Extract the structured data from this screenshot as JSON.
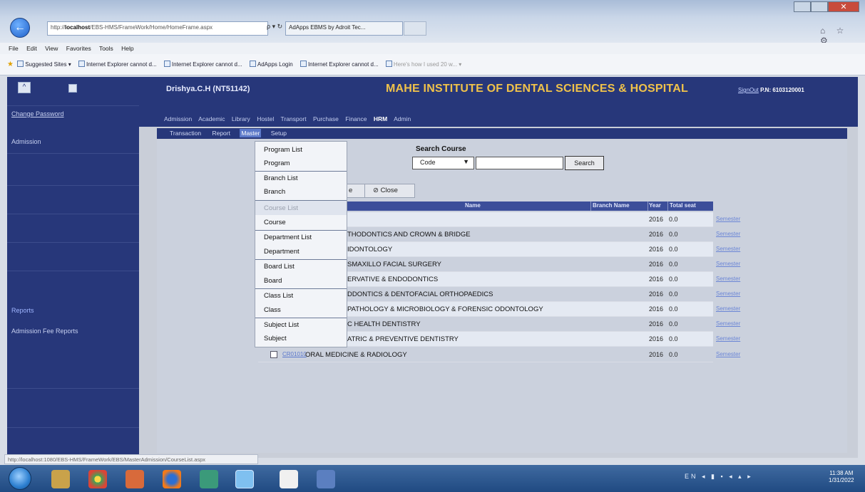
{
  "browser": {
    "address_prefix": "http://",
    "address_host": "localhost",
    "address_rest": "/EBS-HMS/FrameWork/Home/HomeFrame.aspx",
    "address_controls": "ρ ▾ ↻",
    "tab_title": "AdApps EBMS by Adroit Tec...",
    "window_close": "✕",
    "nav_icons": "⌂ ☆ ⚙",
    "menu": [
      "File",
      "Edit",
      "View",
      "Favorites",
      "Tools",
      "Help"
    ],
    "favorites": [
      "Suggested Sites ▾",
      "Internet Explorer cannot d...",
      "Internet Explorer cannot d...",
      "AdApps Login",
      "Internet Explorer cannot d...",
      "Here's how I used 20 w... ▾"
    ],
    "status_url": "http://localhost:1080/EBS-HMS/FrameWork/EBS/MasterAdmission/CourseList.aspx"
  },
  "app": {
    "user": "Drishya.C.H (NT51142)",
    "institution": "MAHE INSTITUTE OF DENTAL SCIENCES & HOSPITAL",
    "signout_label": "SignOut",
    "signout_id": "P.N: 6103120001",
    "sidebar": {
      "top_ctrl": "^",
      "links": [
        "Change Password",
        "Admission"
      ],
      "reports_header": "Reports",
      "report_links": [
        "Admission Fee Reports"
      ]
    },
    "modules": [
      "Admission",
      "Academic",
      "Library",
      "Hostel",
      "Transport",
      "Purchase",
      "Finance",
      "HRM",
      "Admin"
    ],
    "active_module": "HRM",
    "submenu": [
      "Transaction",
      "Report",
      "Master",
      "Setup"
    ],
    "active_submenu": "Master"
  },
  "master_menu": {
    "groups": [
      [
        "Program List",
        "Program"
      ],
      [
        "Branch List",
        "Branch"
      ],
      [
        "Course List",
        "Course"
      ],
      [
        "Department List",
        "Department"
      ],
      [
        "Board List",
        "Board"
      ],
      [
        "Class List",
        "Class"
      ],
      [
        "Subject List",
        "Subject"
      ]
    ],
    "disabled_item": "Course List"
  },
  "search": {
    "label": "Search Course",
    "select_value": "Code",
    "input_value": "",
    "button": "Search"
  },
  "toolbar": {
    "partial": "e",
    "close_label": "⊘ Close"
  },
  "table": {
    "headers": [
      "Name",
      "Branch Name",
      "Year",
      "Total seat"
    ],
    "rows": [
      {
        "name": "",
        "year": "2016",
        "seat": "0.0",
        "action": "Semester"
      },
      {
        "name": "THODONTICS AND CROWN & BRIDGE",
        "year": "2016",
        "seat": "0.0",
        "action": "Semester"
      },
      {
        "name": "IDONTOLOGY",
        "year": "2016",
        "seat": "0.0",
        "action": "Semester"
      },
      {
        "name": "SMAXILLO FACIAL SURGERY",
        "year": "2016",
        "seat": "0.0",
        "action": "Semester"
      },
      {
        "name": "ERVATIVE & ENDODONTICS",
        "year": "2016",
        "seat": "0.0",
        "action": "Semester"
      },
      {
        "name": "DDONTICS & DENTOFACIAL ORTHOPAEDICS",
        "year": "2016",
        "seat": "0.0",
        "action": "Semester"
      },
      {
        "name": "PATHOLOGY & MICROBIOLOGY & FORENSIC ODONTOLOGY",
        "year": "2016",
        "seat": "0.0",
        "action": "Semester"
      },
      {
        "name": "C HEALTH DENTISTRY",
        "year": "2016",
        "seat": "0.0",
        "action": "Semester"
      },
      {
        "name": "ATRIC & PREVENTIVE DENTISTRY",
        "year": "2016",
        "seat": "0.0",
        "action": "Semester"
      }
    ],
    "last_row": {
      "code": "CR01010",
      "name": "ORAL MEDICINE & RADIOLOGY",
      "year": "2016",
      "seat": "0.0",
      "action": "Semester"
    }
  },
  "taskbar": {
    "tray": "EN ◂ ▮ ▪ ◂ ▴ ▸",
    "time": "11:38 AM",
    "date": "1/31/2022"
  }
}
